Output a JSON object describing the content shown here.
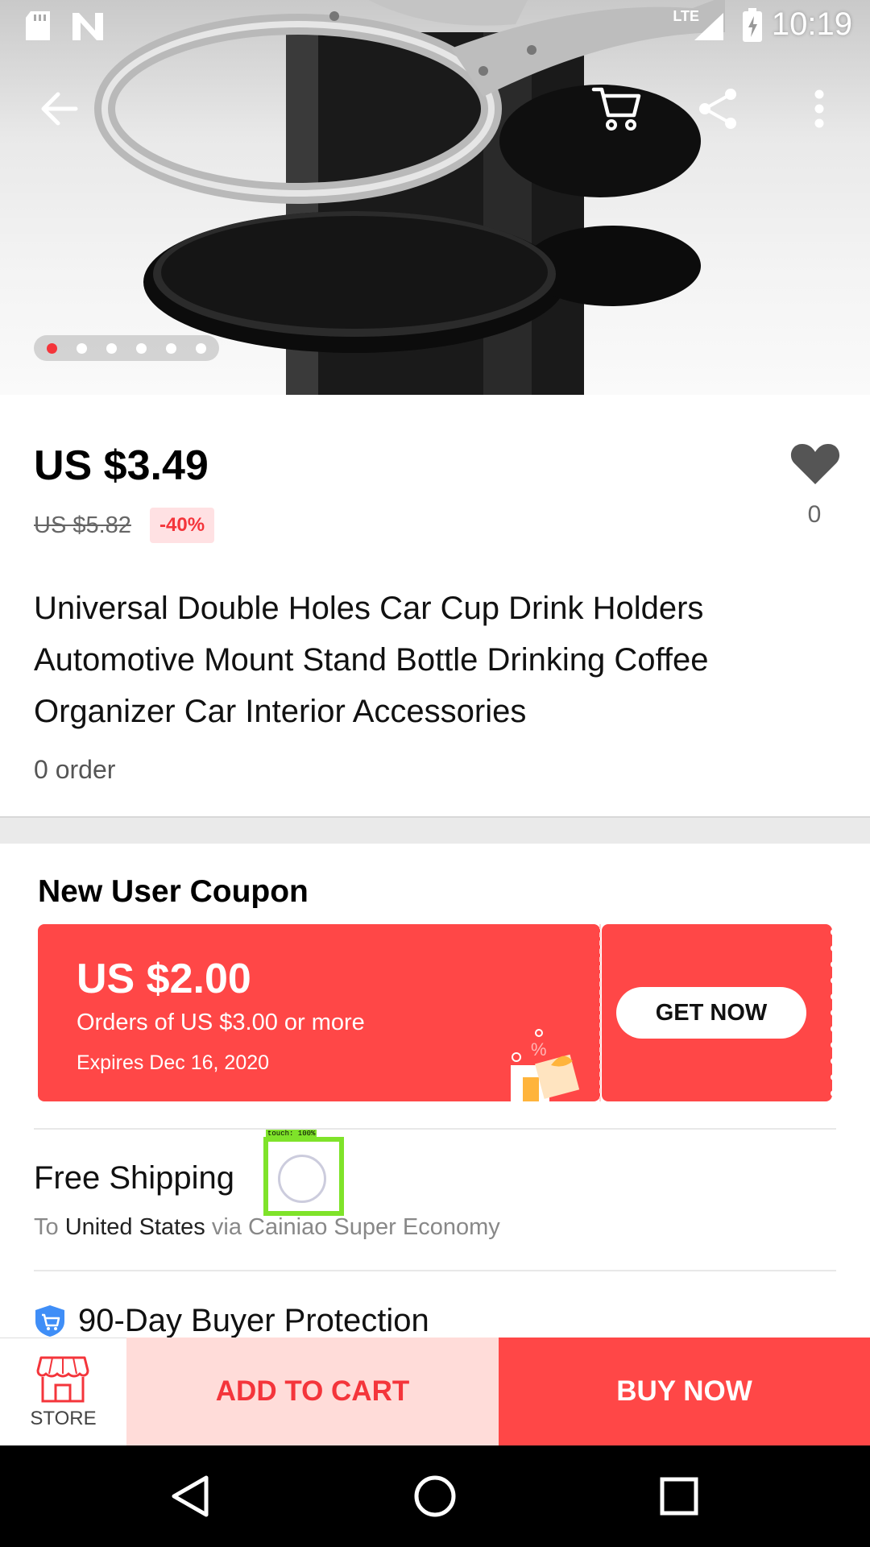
{
  "status_bar": {
    "time": "10:19",
    "network": "LTE"
  },
  "top_nav": {
    "back_icon": "back-arrow-icon",
    "cart_icon": "cart-icon",
    "share_icon": "share-icon",
    "more_icon": "more-icon"
  },
  "gallery": {
    "image_count": 6,
    "active_index": 0
  },
  "product": {
    "price": "US $3.49",
    "original_price": "US $5.82",
    "discount": "-40%",
    "wishlist_count": "0",
    "title": "Universal Double Holes Car Cup Drink Holders Automotive Mount Stand Bottle Drinking Coffee Organizer Car Interior Accessories",
    "orders": "0 order"
  },
  "coupon": {
    "heading": "New User Coupon",
    "amount": "US $2.00",
    "condition": "Orders of US $3.00 or more",
    "expires": "Expires Dec 16, 2020",
    "button": "GET NOW"
  },
  "shipping": {
    "title": "Free Shipping",
    "to_prefix": "To",
    "country": "United States",
    "via": "via Cainiao Super Economy"
  },
  "protection": {
    "title": "90-Day Buyer Protection"
  },
  "touch_overlay": {
    "label": "touch: 100%"
  },
  "bottom_bar": {
    "store": "STORE",
    "add_to_cart": "ADD TO CART",
    "buy_now": "BUY NOW"
  },
  "colors": {
    "accent": "#ff4747",
    "add_cart_bg": "#ffdcd9",
    "discount_text": "#f4353b"
  }
}
